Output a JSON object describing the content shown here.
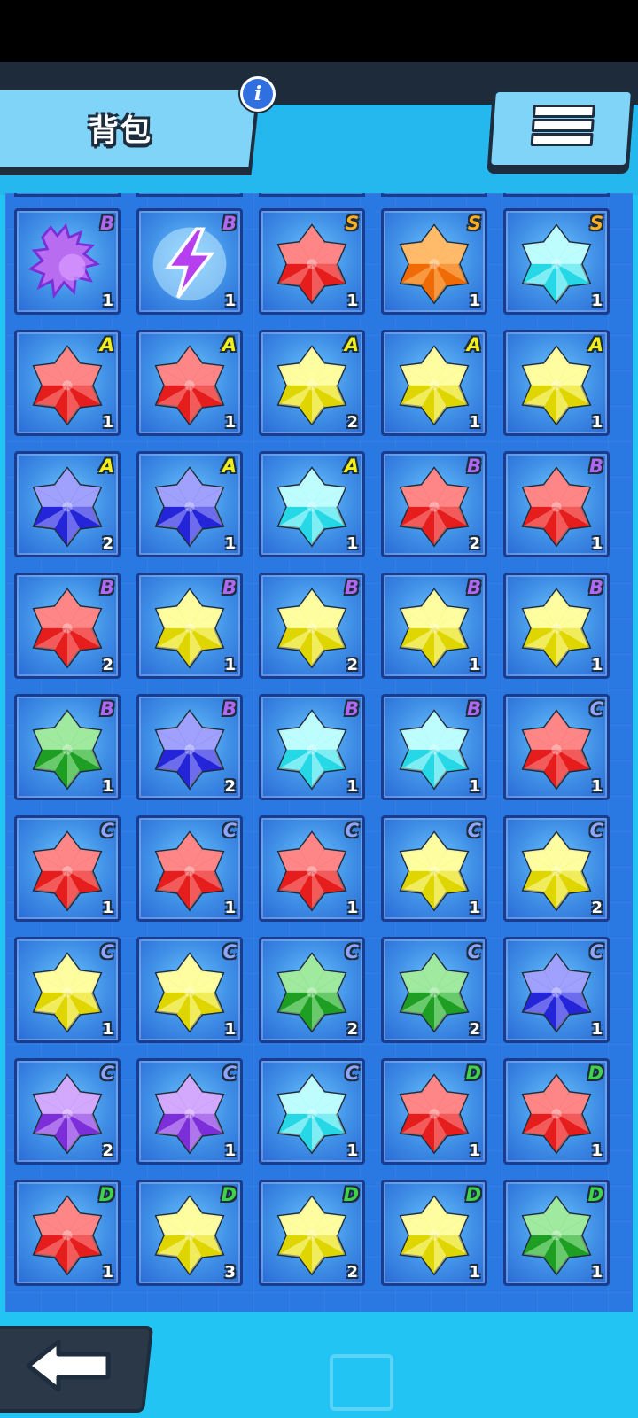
{
  "header": {
    "title": "背包",
    "info_label": "i"
  },
  "grade_colors": {
    "S": "#ffb020",
    "A": "#f2ee1a",
    "B": "#b068f0",
    "C": "#8ea6ff",
    "D": "#3fd24a"
  },
  "colors": {
    "red": [
      "#ff8c8c",
      "#e51d1d"
    ],
    "orange": [
      "#ffc070",
      "#f06a05"
    ],
    "cyan": [
      "#c6ffff",
      "#26d8e6"
    ],
    "yellow": [
      "#ffffa8",
      "#dfd600"
    ],
    "blue": [
      "#a8a8ff",
      "#2424d8"
    ],
    "green": [
      "#a6eea6",
      "#1f9e24"
    ],
    "purple": [
      "#d8b0ff",
      "#7c2ed8"
    ]
  },
  "items": [
    {
      "icon": "dragon-icon",
      "color": "purple",
      "grade": "B",
      "count": "1"
    },
    {
      "icon": "lightning-icon",
      "color": "purple",
      "grade": "B",
      "count": "1"
    },
    {
      "icon": "gem-icon",
      "color": "red",
      "grade": "S",
      "count": "1"
    },
    {
      "icon": "gem-icon",
      "color": "orange",
      "grade": "S",
      "count": "1"
    },
    {
      "icon": "gem-icon",
      "color": "cyan",
      "grade": "S",
      "count": "1"
    },
    {
      "icon": "gem-icon",
      "color": "red",
      "grade": "A",
      "count": "1"
    },
    {
      "icon": "gem-icon",
      "color": "red",
      "grade": "A",
      "count": "1"
    },
    {
      "icon": "gem-icon",
      "color": "yellow",
      "grade": "A",
      "count": "2"
    },
    {
      "icon": "gem-icon",
      "color": "yellow",
      "grade": "A",
      "count": "1"
    },
    {
      "icon": "gem-icon",
      "color": "yellow",
      "grade": "A",
      "count": "1"
    },
    {
      "icon": "gem-icon",
      "color": "blue",
      "grade": "A",
      "count": "2"
    },
    {
      "icon": "gem-icon",
      "color": "blue",
      "grade": "A",
      "count": "1"
    },
    {
      "icon": "gem-icon",
      "color": "cyan",
      "grade": "A",
      "count": "1"
    },
    {
      "icon": "gem-icon",
      "color": "red",
      "grade": "B",
      "count": "2"
    },
    {
      "icon": "gem-icon",
      "color": "red",
      "grade": "B",
      "count": "1"
    },
    {
      "icon": "gem-icon",
      "color": "red",
      "grade": "B",
      "count": "2"
    },
    {
      "icon": "gem-icon",
      "color": "yellow",
      "grade": "B",
      "count": "1"
    },
    {
      "icon": "gem-icon",
      "color": "yellow",
      "grade": "B",
      "count": "2"
    },
    {
      "icon": "gem-icon",
      "color": "yellow",
      "grade": "B",
      "count": "1"
    },
    {
      "icon": "gem-icon",
      "color": "yellow",
      "grade": "B",
      "count": "1"
    },
    {
      "icon": "gem-icon",
      "color": "green",
      "grade": "B",
      "count": "1"
    },
    {
      "icon": "gem-icon",
      "color": "blue",
      "grade": "B",
      "count": "2"
    },
    {
      "icon": "gem-icon",
      "color": "cyan",
      "grade": "B",
      "count": "1"
    },
    {
      "icon": "gem-icon",
      "color": "cyan",
      "grade": "B",
      "count": "1"
    },
    {
      "icon": "gem-icon",
      "color": "red",
      "grade": "C",
      "count": "1"
    },
    {
      "icon": "gem-icon",
      "color": "red",
      "grade": "C",
      "count": "1"
    },
    {
      "icon": "gem-icon",
      "color": "red",
      "grade": "C",
      "count": "1"
    },
    {
      "icon": "gem-icon",
      "color": "red",
      "grade": "C",
      "count": "1"
    },
    {
      "icon": "gem-icon",
      "color": "yellow",
      "grade": "C",
      "count": "1"
    },
    {
      "icon": "gem-icon",
      "color": "yellow",
      "grade": "C",
      "count": "2"
    },
    {
      "icon": "gem-icon",
      "color": "yellow",
      "grade": "C",
      "count": "1"
    },
    {
      "icon": "gem-icon",
      "color": "yellow",
      "grade": "C",
      "count": "1"
    },
    {
      "icon": "gem-icon",
      "color": "green",
      "grade": "C",
      "count": "2"
    },
    {
      "icon": "gem-icon",
      "color": "green",
      "grade": "C",
      "count": "2"
    },
    {
      "icon": "gem-icon",
      "color": "blue",
      "grade": "C",
      "count": "1"
    },
    {
      "icon": "gem-icon",
      "color": "purple",
      "grade": "C",
      "count": "2"
    },
    {
      "icon": "gem-icon",
      "color": "purple",
      "grade": "C",
      "count": "1"
    },
    {
      "icon": "gem-icon",
      "color": "cyan",
      "grade": "C",
      "count": "1"
    },
    {
      "icon": "gem-icon",
      "color": "red",
      "grade": "D",
      "count": "1"
    },
    {
      "icon": "gem-icon",
      "color": "red",
      "grade": "D",
      "count": "1"
    },
    {
      "icon": "gem-icon",
      "color": "red",
      "grade": "D",
      "count": "1"
    },
    {
      "icon": "gem-icon",
      "color": "yellow",
      "grade": "D",
      "count": "3"
    },
    {
      "icon": "gem-icon",
      "color": "yellow",
      "grade": "D",
      "count": "2"
    },
    {
      "icon": "gem-icon",
      "color": "yellow",
      "grade": "D",
      "count": "1"
    },
    {
      "icon": "gem-icon",
      "color": "green",
      "grade": "D",
      "count": "1"
    }
  ]
}
